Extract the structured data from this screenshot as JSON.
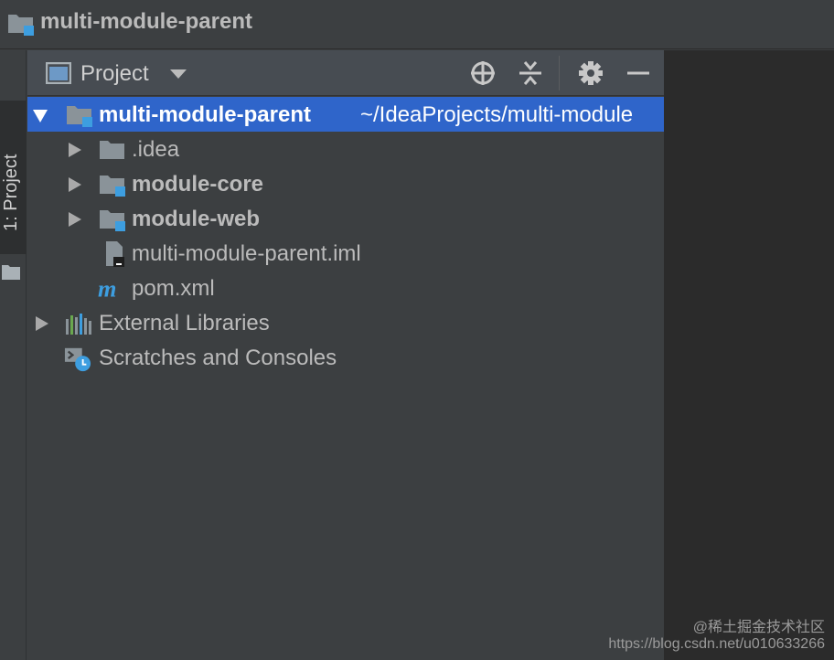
{
  "window": {
    "title": "multi-module-parent"
  },
  "tool_strip": {
    "project_tab_label": "1: Project"
  },
  "panel": {
    "view_label": "Project",
    "actions": [
      "locate-icon",
      "collapse-all-icon",
      "gear-icon",
      "minimize-icon"
    ]
  },
  "tree": {
    "root": {
      "label": "multi-module-parent",
      "path": "~/IdeaProjects/multi-module"
    },
    "idea": {
      "label": ".idea"
    },
    "module_core": {
      "label": "module-core"
    },
    "module_web": {
      "label": "module-web"
    },
    "iml": {
      "label": "multi-module-parent.iml"
    },
    "pom": {
      "label": "pom.xml"
    },
    "ext_libs": {
      "label": "External Libraries"
    },
    "scratches": {
      "label": "Scratches and Consoles"
    }
  },
  "watermark": {
    "line1": "@稀土掘金技术社区",
    "line2": "https://blog.csdn.net/u010633266"
  },
  "colors": {
    "selection": "#2f65ca",
    "panel_bg": "#3c3f41",
    "editor_bg": "#2b2b2b",
    "module_badge": "#3d9ee0"
  }
}
